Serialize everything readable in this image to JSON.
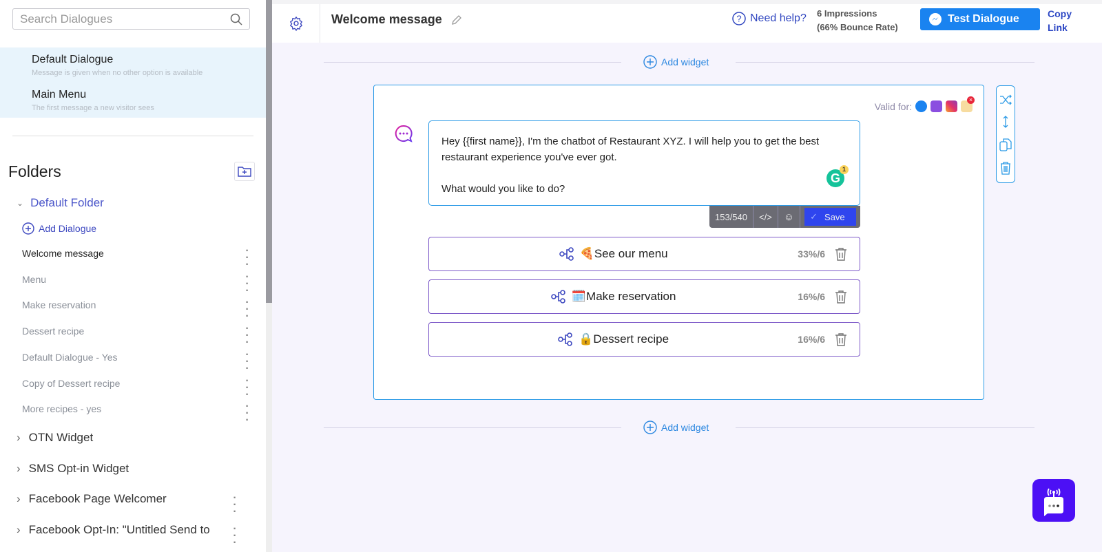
{
  "sidebar": {
    "search_placeholder": "Search Dialogues",
    "system_dialogues": [
      {
        "title": "Default Dialogue",
        "subtitle": "Message is given when no other option is available"
      },
      {
        "title": "Main Menu",
        "subtitle": "The first message a new visitor sees"
      }
    ],
    "folders_title": "Folders",
    "open_folder": "Default Folder",
    "add_dialogue": "Add Dialogue",
    "dialogues": [
      "Welcome message",
      "Menu",
      "Make reservation",
      "Dessert recipe",
      "Default Dialogue - Yes",
      "Copy of Dessert recipe",
      "More recipes - yes"
    ],
    "folders": [
      "OTN Widget",
      "SMS Opt-in Widget",
      "Facebook Page Welcomer",
      "Facebook Opt-In: \"Untitled Send to"
    ]
  },
  "header": {
    "title": "Welcome message",
    "help": "Need help?",
    "impressions": "6 Impressions (66% Bounce Rate)",
    "test_button": "Test Dialogue",
    "copy_link": "Copy Link"
  },
  "main": {
    "add_widget": "Add widget",
    "valid_for": "Valid for:",
    "message_line1": "Hey {{first name}}, I'm the chatbot of Restaurant XYZ. I will help you to get the best restaurant experience you've ever got.",
    "message_line2": "What would you like to do?",
    "char_count": "153/540",
    "code_label": "</>",
    "save": "Save",
    "grammarly_count": "1",
    "quick_replies": [
      {
        "emoji": "🍕",
        "label": "See our menu",
        "stat": "33%/6"
      },
      {
        "emoji": "🗓️",
        "label": "Make reservation",
        "stat": "16%/6"
      },
      {
        "emoji": "🔒",
        "label": "Dessert recipe",
        "stat": "16%/6"
      }
    ]
  },
  "colors": {
    "accent": "#1a83f0",
    "border": "#2b9ae6",
    "quick_reply_border": "#7c58c8",
    "save": "#2f45ee",
    "bot": "#4c10f5"
  }
}
